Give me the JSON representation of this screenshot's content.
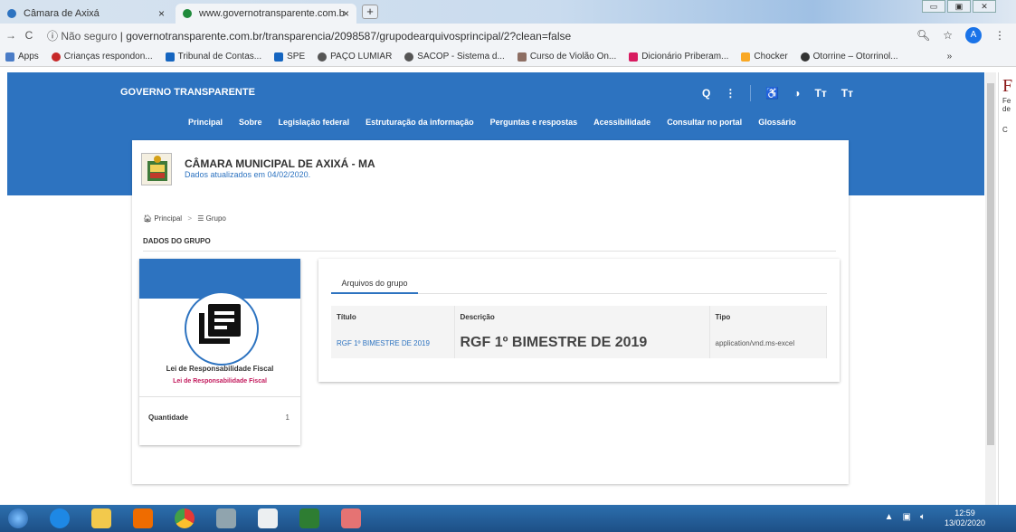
{
  "browser": {
    "tabs": [
      {
        "label": "Câmara de Axixá",
        "close": "×"
      },
      {
        "label": "www.governotransparente.com.b",
        "close": "×"
      }
    ],
    "new_tab": "+",
    "url_prefix": "Não seguro",
    "url": "governotransparente.com.br/transparencia/2098587/grupodearquivosprincipal/2?clean=false",
    "profile_initial": "A",
    "bookmarks": [
      "Apps",
      "Crianças respondon...",
      "Tribunal de Contas...",
      "SPE",
      "PAÇO LUMIAR",
      "SACOP - Sistema d...",
      "Curso de Violão On...",
      "Dicionário Priberam...",
      "Chocker",
      "Otorrine – Otorrinol..."
    ],
    "bookmarks_more": "»"
  },
  "site": {
    "brand": "GOVERNO TRANSPARENTE",
    "tools": [
      "Q",
      "⋮",
      "♿",
      "◑",
      "Tт",
      "Tт"
    ],
    "menu": [
      "Principal",
      "Sobre",
      "Legislação federal",
      "Estruturação da informação",
      "Perguntas e respostas",
      "Acessibilidade",
      "Consultar no portal",
      "Glossário"
    ]
  },
  "org": {
    "name": "CÂMARA MUNICIPAL DE AXIXÁ - MA",
    "updated": "Dados atualizados em 04/02/2020."
  },
  "breadcrumb": {
    "home": "Principal",
    "sep": ">",
    "current": "Grupo"
  },
  "section_title": "DADOS DO GRUPO",
  "group": {
    "name": "Lei de Responsabilidade Fiscal",
    "subtitle": "Lei de Responsabilidade Fiscal",
    "quantity_label": "Quantidade",
    "quantity_value": "1"
  },
  "files": {
    "tab_label": "Arquivos do grupo",
    "columns": [
      "Título",
      "Descrição",
      "Tipo"
    ],
    "rows": [
      {
        "title": "RGF 1º BIMESTRE DE 2019",
        "description": "RGF 1º BIMESTRE DE 2019",
        "type": "application/vnd.ms-excel"
      }
    ]
  },
  "right_panel": {
    "big_letter": "F",
    "line1": "Fe",
    "line2": "de",
    "line3": "C"
  },
  "taskbar": {
    "time": "12:59",
    "date": "13/02/2020"
  },
  "colors": {
    "primary": "#2d73c0",
    "accent_pink": "#c2185b"
  }
}
